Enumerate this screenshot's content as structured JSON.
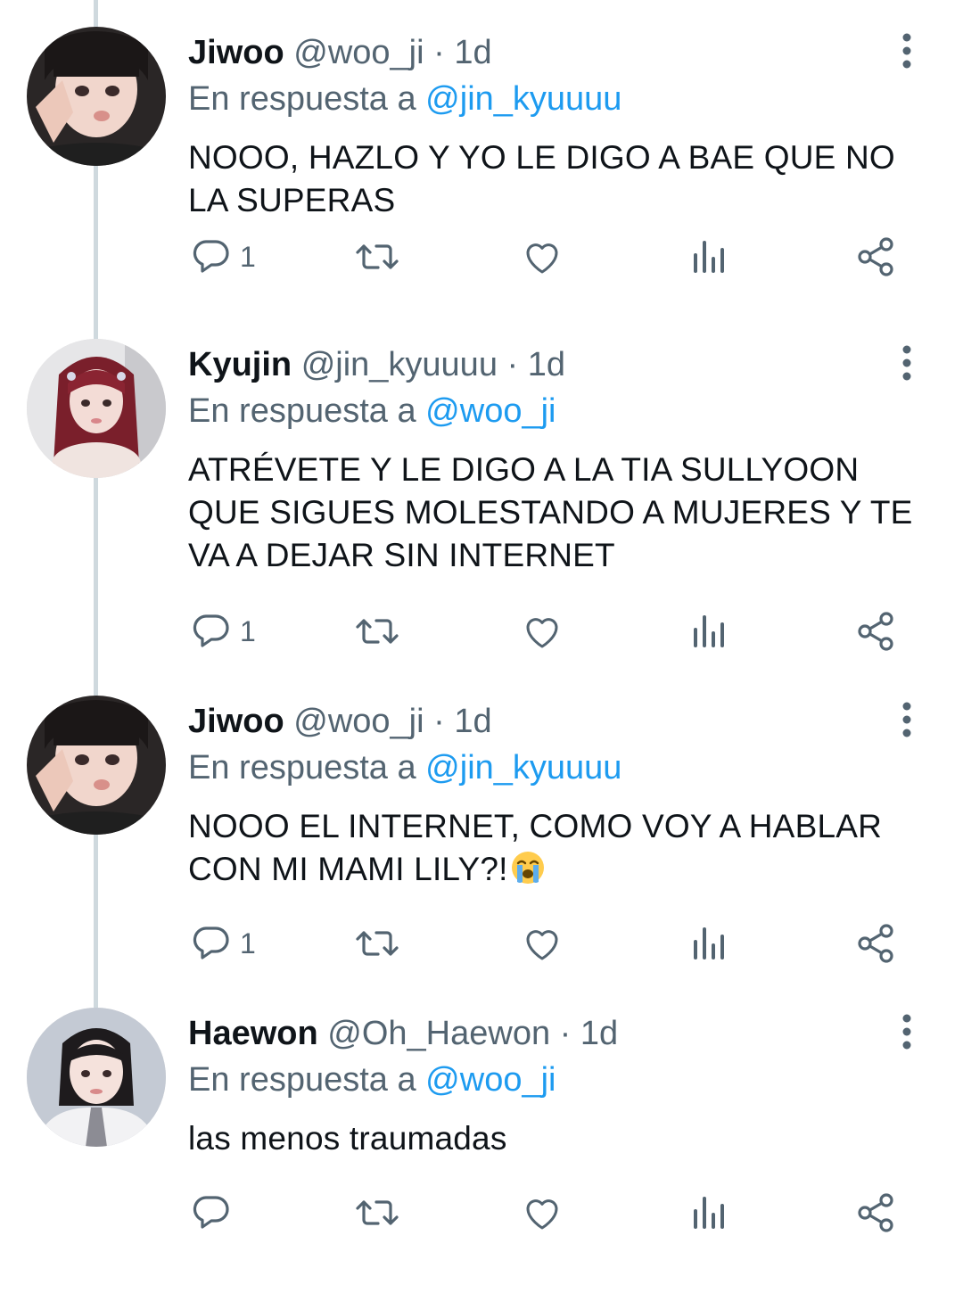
{
  "tweets": [
    {
      "name": "Jiwoo",
      "handle": "@woo_ji",
      "separator": "·",
      "time": "1d",
      "replying_prefix": "En respuesta a",
      "replying_to": "@jin_kyuuuu",
      "text": "NOOO, HAZLO Y YO LE DIGO A BAE QUE NO LA SUPERAS",
      "reply_count": "1"
    },
    {
      "name": "Kyujin",
      "handle": "@jin_kyuuuu",
      "separator": "·",
      "time": "1d",
      "replying_prefix": "En respuesta a",
      "replying_to": "@woo_ji",
      "text": "ATRÉVETE Y LE DIGO A LA TIA SULLYOON QUE SIGUES MOLESTANDO A MUJERES Y TE VA A DEJAR SIN INTERNET",
      "reply_count": "1"
    },
    {
      "name": "Jiwoo",
      "handle": "@woo_ji",
      "separator": "·",
      "time": "1d",
      "replying_prefix": "En respuesta a",
      "replying_to": "@jin_kyuuuu",
      "text": "NOOO EL INTERNET, COMO VOY A HABLAR CON MI MAMI LILY?!",
      "emoji": "loudly-crying-face",
      "reply_count": "1"
    },
    {
      "name": "Haewon",
      "handle": "@Oh_Haewon",
      "separator": "·",
      "time": "1d",
      "replying_prefix": "En respuesta a",
      "replying_to": "@woo_ji",
      "text": "las menos traumadas",
      "reply_count": ""
    }
  ],
  "icons": {
    "reply": "reply-icon",
    "retweet": "retweet-icon",
    "like": "like-icon",
    "views": "views-icon",
    "share": "share-icon",
    "more": "more-icon"
  },
  "colors": {
    "text": "#0f1419",
    "secondary": "#536471",
    "mention": "#1d9bf0",
    "thread_line": "#cfd9de"
  }
}
